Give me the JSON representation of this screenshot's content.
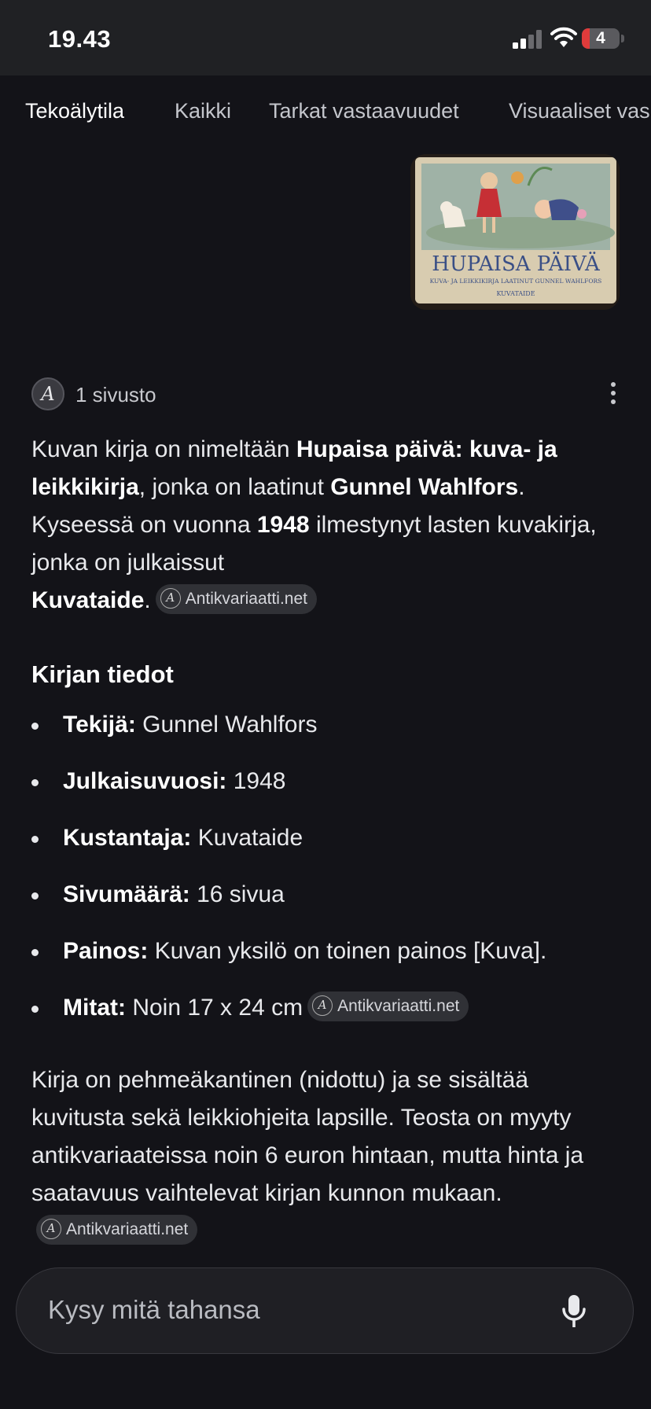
{
  "status_bar": {
    "time": "19.43",
    "battery_level": "4",
    "battery_color": "#e03b3b",
    "icons": [
      "signal-icon",
      "wifi-icon",
      "battery-icon"
    ]
  },
  "tabs": [
    {
      "label": "Tekoälytila",
      "active": true
    },
    {
      "label": "Kaikki",
      "active": false
    },
    {
      "label": "Tarkat vastaavuudet",
      "active": false
    },
    {
      "label": "Visuaaliset vas",
      "active": false
    }
  ],
  "image_result": {
    "book_title": "HUPAISA PÄIVÄ",
    "book_subtitle": "KUVA- JA LEIKKIKIRJA LAATINUT GUNNEL WAHLFORS",
    "book_publisher": "KUVATAIDE"
  },
  "sources": {
    "avatar_letter": "A",
    "count_label": "1 sivusto"
  },
  "answer": {
    "intro": {
      "t1": "Kuvan kirja on nimeltään ",
      "b1": "Hupaisa päivä: kuva- ja leikkikirja",
      "t2": ", jonka on laatinut ",
      "b2": "Gunnel Wahlfors",
      "t3": ". Kyseessä on vuonna ",
      "b3": "1948",
      "t4": " ilmestynyt lasten kuvakirja, jonka on julkaissut ",
      "b4": "Kuvataide",
      "t5": ".",
      "citation": "Antikvariaatti.net"
    },
    "section_heading": "Kirjan tiedot",
    "facts": [
      {
        "label": "Tekijä:",
        "value": " Gunnel Wahlfors",
        "citation": ""
      },
      {
        "label": "Julkaisuvuosi:",
        "value": " 1948",
        "citation": ""
      },
      {
        "label": "Kustantaja:",
        "value": " Kuvataide",
        "citation": ""
      },
      {
        "label": "Sivumäärä:",
        "value": " 16 sivua",
        "citation": ""
      },
      {
        "label": "Painos:",
        "value": " Kuvan yksilö on toinen painos [Kuva].",
        "citation": ""
      },
      {
        "label": "Mitat:",
        "value": " Noin 17 x 24 cm",
        "citation": "Antikvariaatti.net"
      }
    ],
    "closing": {
      "text": "Kirja on pehmeäkantinen (nidottu) ja se sisältää kuvitusta sekä leikkiohjeita lapsille. Teosta on myyty antikvariaateissa noin 6 euron hintaan, mutta hinta ja saatavuus vaihtelevat kirjan kunnon mukaan.",
      "citation": "Antikvariaatti.net"
    }
  },
  "ask_bar": {
    "placeholder": "Kysy mitä tahansa"
  }
}
